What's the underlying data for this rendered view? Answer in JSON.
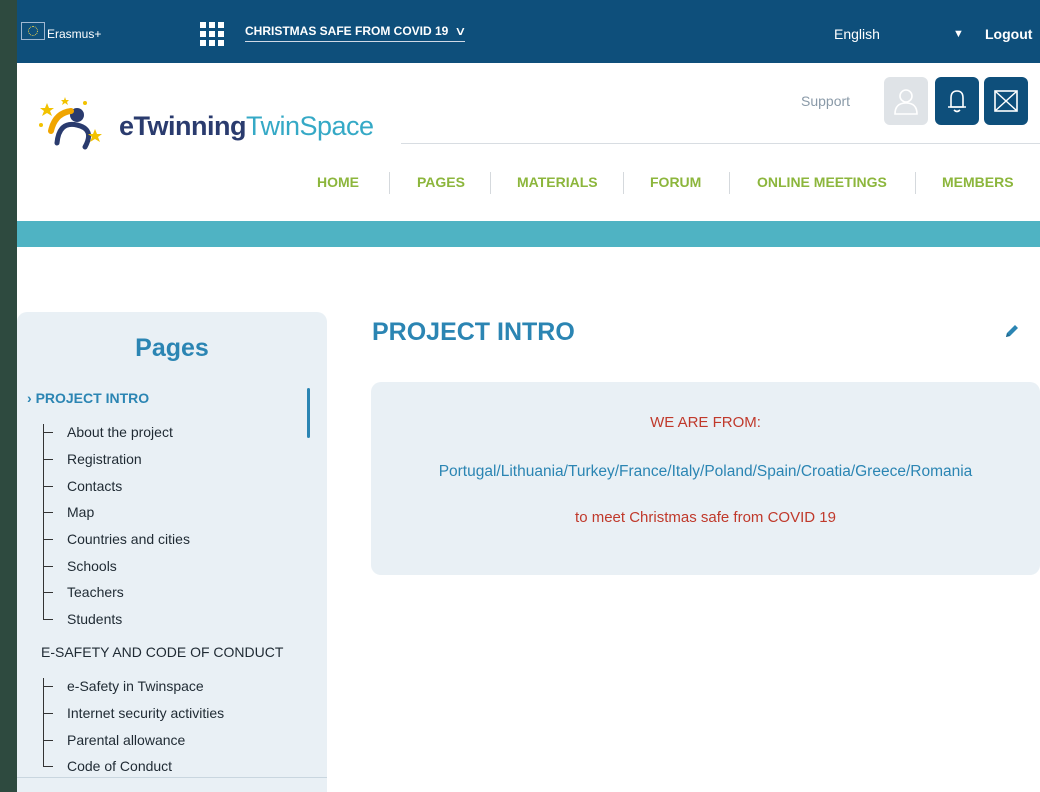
{
  "topbar": {
    "brand": "Erasmus+",
    "project_title": "CHRISTMAS SAFE FROM COVID 19",
    "language": "English",
    "logout": "Logout"
  },
  "header": {
    "logo_part1": "eTwinning",
    "logo_part2": "TwinSpace",
    "support": "Support"
  },
  "nav": [
    {
      "label": "HOME"
    },
    {
      "label": "PAGES"
    },
    {
      "label": "MATERIALS"
    },
    {
      "label": "FORUM"
    },
    {
      "label": "ONLINE MEETINGS"
    },
    {
      "label": "MEMBERS"
    }
  ],
  "sidebar": {
    "title": "Pages",
    "section1": {
      "label": "PROJECT INTRO",
      "items": [
        "About the project",
        "Registration",
        "Contacts",
        "Map",
        "Countries and cities",
        "Schools",
        "Teachers",
        "Students"
      ]
    },
    "section2": {
      "label": "E-SAFETY AND CODE OF CONDUCT",
      "items": [
        "e-Safety in Twinspace",
        "Internet security activities",
        "Parental allowance",
        "Code of Conduct"
      ]
    }
  },
  "main": {
    "title": "PROJECT INTRO",
    "line1": "WE ARE FROM:",
    "line2": "Portugal/Lithuania/Turkey/France/Italy/Poland/Spain/Croatia/Greece/Romania",
    "line3": "to meet Christmas safe from COVID 19"
  },
  "colors": {
    "topbar": "#0e4f7b",
    "nav_green": "#8cb63c",
    "teal_band": "#4fb3c3",
    "heading_blue": "#2b85b3",
    "accent_red": "#c0392b"
  }
}
